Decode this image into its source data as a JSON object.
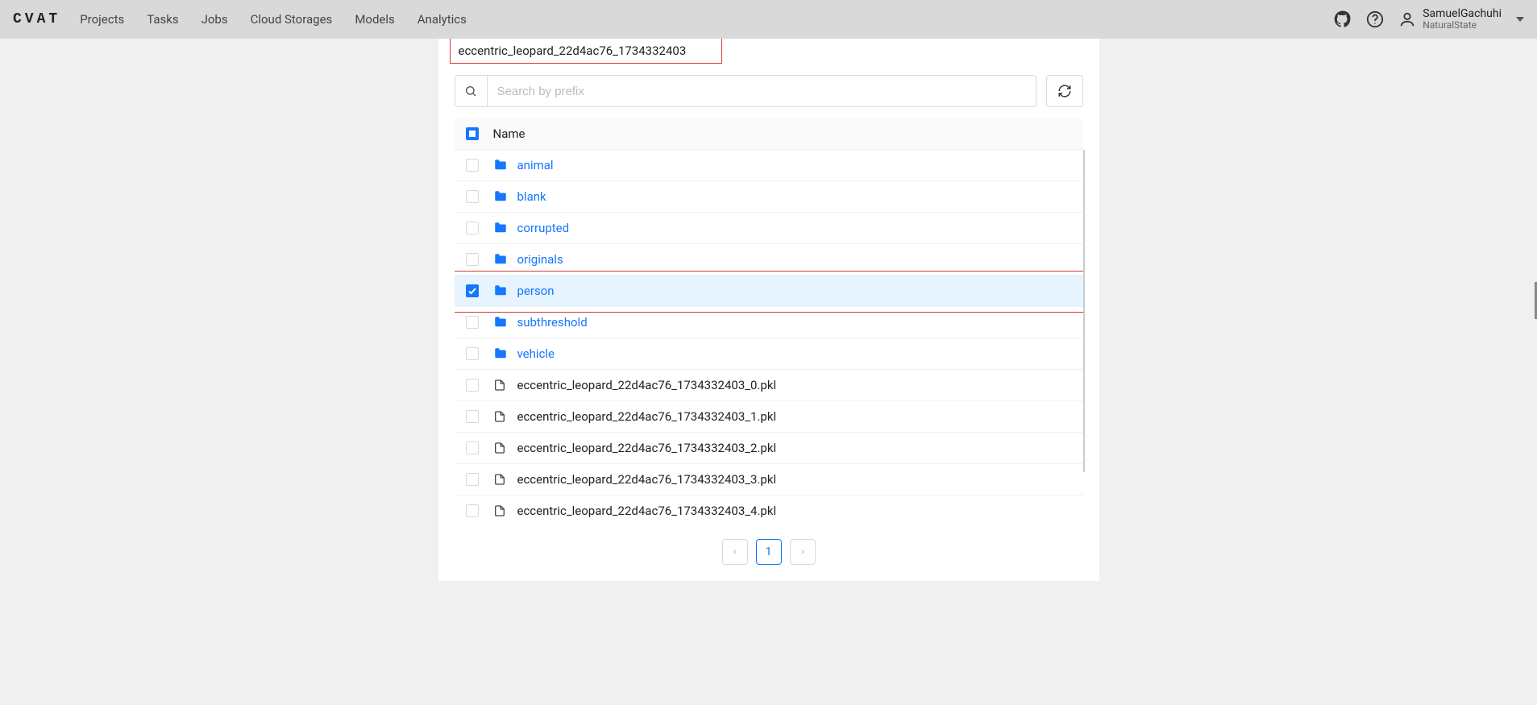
{
  "brand": "CVAT",
  "nav": [
    "Projects",
    "Tasks",
    "Jobs",
    "Cloud Storages",
    "Models",
    "Analytics"
  ],
  "user": {
    "name": "SamuelGachuhi",
    "org": "NaturalState"
  },
  "breadcrumb_leaf": "eccentric_leopard_22d4ac76_1734332403",
  "search": {
    "placeholder": "Search by prefix"
  },
  "columns": {
    "name": "Name"
  },
  "header_check_state": "indeterminate",
  "rows": [
    {
      "type": "folder",
      "name": "animal",
      "checked": false,
      "highlight": false
    },
    {
      "type": "folder",
      "name": "blank",
      "checked": false,
      "highlight": false
    },
    {
      "type": "folder",
      "name": "corrupted",
      "checked": false,
      "highlight": false
    },
    {
      "type": "folder",
      "name": "originals",
      "checked": false,
      "highlight": false
    },
    {
      "type": "folder",
      "name": "person",
      "checked": true,
      "highlight": true
    },
    {
      "type": "folder",
      "name": "subthreshold",
      "checked": false,
      "highlight": false
    },
    {
      "type": "folder",
      "name": "vehicle",
      "checked": false,
      "highlight": false
    },
    {
      "type": "file",
      "name": "eccentric_leopard_22d4ac76_1734332403_0.pkl",
      "checked": false,
      "highlight": false
    },
    {
      "type": "file",
      "name": "eccentric_leopard_22d4ac76_1734332403_1.pkl",
      "checked": false,
      "highlight": false
    },
    {
      "type": "file",
      "name": "eccentric_leopard_22d4ac76_1734332403_2.pkl",
      "checked": false,
      "highlight": false
    },
    {
      "type": "file",
      "name": "eccentric_leopard_22d4ac76_1734332403_3.pkl",
      "checked": false,
      "highlight": false
    },
    {
      "type": "file",
      "name": "eccentric_leopard_22d4ac76_1734332403_4.pkl",
      "checked": false,
      "highlight": false
    }
  ],
  "pagination": {
    "current": "1",
    "prev_disabled": true,
    "next_disabled": true
  }
}
